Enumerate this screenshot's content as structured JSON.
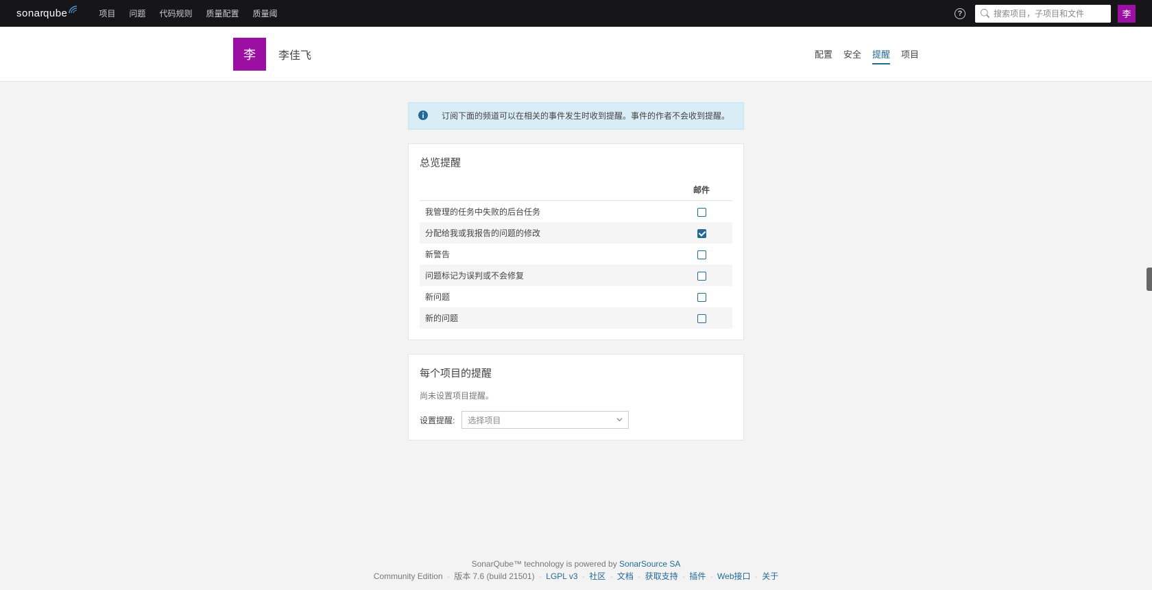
{
  "brand": {
    "first": "sonar",
    "second": "qube"
  },
  "nav": {
    "projects": "项目",
    "issues": "问题",
    "rules": "代码规则",
    "quality_profiles": "质量配置",
    "quality_gates": "质量阈"
  },
  "search": {
    "placeholder": "搜索项目，子项目和文件"
  },
  "avatar": {
    "initial": "李"
  },
  "profile": {
    "avatar_initial": "李",
    "name": "李佳飞"
  },
  "tabs": {
    "t0": "配置",
    "t1": "安全",
    "t2": "提醒",
    "t3": "项目"
  },
  "info_banner": "订阅下面的频道可以在相关的事件发生时收到提醒。事件的作者不会收到提醒。",
  "overall": {
    "title": "总览提醒",
    "channel_header": "邮件",
    "rows": [
      {
        "label": "我管理的任务中失败的后台任务",
        "checked": false
      },
      {
        "label": "分配给我或我报告的问题的修改",
        "checked": true
      },
      {
        "label": "新警告",
        "checked": false
      },
      {
        "label": "问题标记为误判或不会修复",
        "checked": false
      },
      {
        "label": "新问题",
        "checked": false
      },
      {
        "label": "新的问题",
        "checked": false
      }
    ]
  },
  "per_project": {
    "title": "每个项目的提醒",
    "empty": "尚未设置项目提醒。",
    "label": "设置提醒:",
    "select_placeholder": "选择项目"
  },
  "footer": {
    "line1_a": "SonarQube™ technology is powered by ",
    "line1_b": "SonarSource SA",
    "l2_edition": "Community Edition",
    "l2_version": "版本 7.6 (build 21501)",
    "l2_lgpl": "LGPL v3",
    "l2_community": "社区",
    "l2_docs": "文档",
    "l2_support": "获取支持",
    "l2_plugins": "插件",
    "l2_api": "Web接口",
    "l2_about": "关于"
  }
}
